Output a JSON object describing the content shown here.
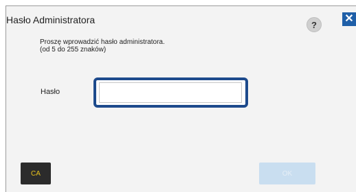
{
  "dialog": {
    "title": "Hasło Administratora",
    "help_label": "?",
    "close_label": "✕",
    "instructions": {
      "line1": "Proszę wprowadzić hasło administratora.",
      "line2": "(od 5 do 255 znaków)"
    },
    "password": {
      "label": "Hasło",
      "value": "",
      "placeholder": ""
    },
    "buttons": {
      "ca_label": "CA",
      "ok_label": "OK"
    }
  },
  "colors": {
    "accent_blue": "#1d4a8c",
    "close_blue": "#1f5fa8",
    "ca_text_yellow": "#e8c21c",
    "ok_disabled_bg": "#c9def0"
  }
}
